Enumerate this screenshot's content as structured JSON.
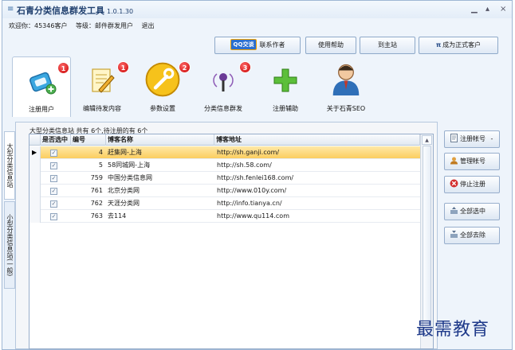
{
  "window": {
    "title": "石青分类信息群发工具",
    "version": "1.0.1.30",
    "controls": {
      "minimize": "▁",
      "restore": "▴",
      "close": "×"
    }
  },
  "userbar": {
    "welcome": "欢迎你：45346客户",
    "level": "等级：邮件群发用户",
    "logout": "退出"
  },
  "top_buttons": {
    "qq_badge": "QQ交谈",
    "contact": "联系作者",
    "help": "使用帮助",
    "site": "到主站",
    "upgrade": "成为正式客户",
    "upgrade_icon": "π"
  },
  "ribbon": [
    {
      "label": "注册用户",
      "badge": "1",
      "icon": "register-user-icon",
      "active": true
    },
    {
      "label": "编辑待发内容",
      "badge": "1",
      "icon": "edit-content-icon",
      "active": false
    },
    {
      "label": "参数设置",
      "badge": "2",
      "icon": "settings-wrench-icon",
      "active": false
    },
    {
      "label": "分类信息群发",
      "badge": "3",
      "icon": "broadcast-icon",
      "active": false
    },
    {
      "label": "注册辅助",
      "badge": "",
      "icon": "plus-icon",
      "active": false
    },
    {
      "label": "关于石青SEO",
      "badge": "",
      "icon": "about-avatar-icon",
      "active": false
    }
  ],
  "vtabs": {
    "tab1": "大型分类信息站",
    "tab2": "小型分类信息站(一般)"
  },
  "grid": {
    "caption": "大型分类信息站 共有 6个,待注册的有 6个",
    "columns": [
      "是否选中",
      "编号",
      "博客名称",
      "博客地址"
    ],
    "rows": [
      {
        "id": "4",
        "name": "赶集网-上海",
        "url": "http://sh.ganji.com/",
        "checked": true,
        "selected": true
      },
      {
        "id": "5",
        "name": "58同城网-上海",
        "url": "http://sh.58.com/",
        "checked": true,
        "selected": false
      },
      {
        "id": "759",
        "name": "中国分类信息网",
        "url": "http://sh.fenlei168.com/",
        "checked": true,
        "selected": false
      },
      {
        "id": "761",
        "name": "北京分类网",
        "url": "http://www.010y.com/",
        "checked": true,
        "selected": false
      },
      {
        "id": "762",
        "name": "天涯分类网",
        "url": "http://info.tianya.cn/",
        "checked": true,
        "selected": false
      },
      {
        "id": "763",
        "name": "去114",
        "url": "http://www.qu114.com",
        "checked": true,
        "selected": false
      }
    ],
    "check_glyph": "✓",
    "row_pointer": "▶"
  },
  "side_buttons": {
    "register": "注册帐号",
    "register_arrow": "-",
    "manage": "管理帐号",
    "stop": "停止注册",
    "select_all": "全部选中",
    "clear_all": "全部去除"
  },
  "watermark": "最需教育",
  "colors": {
    "badge_red": "#d40000",
    "selected_row": "#fbcd5f",
    "accent_blue": "#2a6fd1"
  }
}
